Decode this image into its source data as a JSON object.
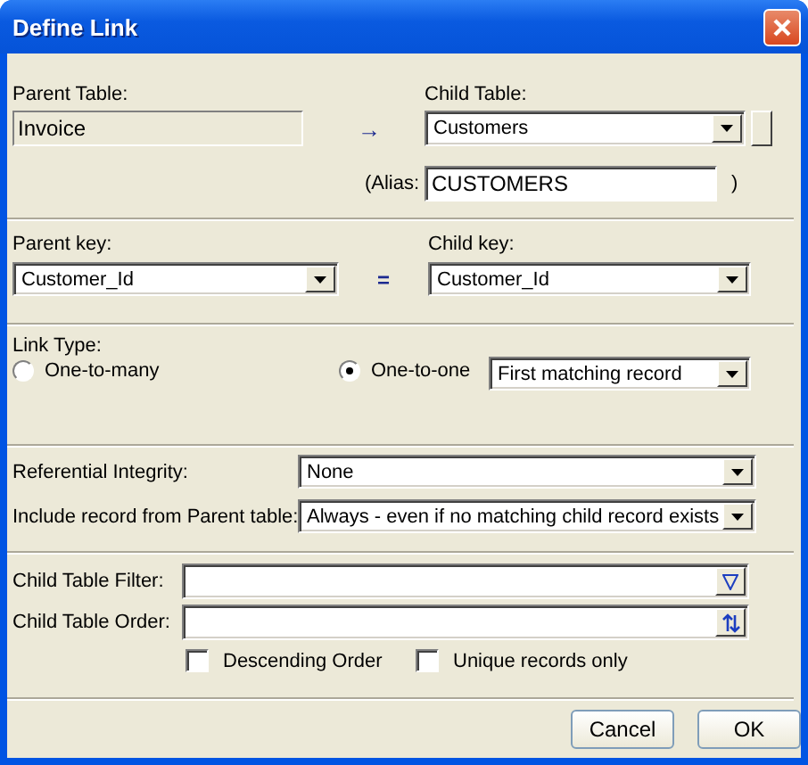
{
  "window": {
    "title": "Define Link"
  },
  "parent_table": {
    "label": "Parent Table:",
    "value": "Invoice"
  },
  "arrow": "→",
  "child_table": {
    "label": "Child Table:",
    "value": "Customers"
  },
  "alias": {
    "label": "(Alias:",
    "value": "CUSTOMERS",
    "close": ")"
  },
  "parent_key": {
    "label": "Parent key:",
    "value": "Customer_Id"
  },
  "equals": "=",
  "child_key": {
    "label": "Child key:",
    "value": "Customer_Id"
  },
  "link_type": {
    "label": "Link Type:",
    "options": [
      {
        "label": "One-to-many",
        "selected": false
      },
      {
        "label": "One-to-one",
        "selected": true
      }
    ],
    "match": "First matching record"
  },
  "referential_integrity": {
    "label": "Referential Integrity:",
    "value": "None"
  },
  "include_record": {
    "label": "Include record from Parent table:",
    "value": "Always - even if no matching child record exists"
  },
  "child_filter": {
    "label": "Child Table Filter:"
  },
  "child_order": {
    "label": "Child Table Order:"
  },
  "options": [
    {
      "label": "Descending Order",
      "checked": false
    },
    {
      "label": "Unique records only",
      "checked": false
    }
  ],
  "buttons": [
    "Cancel",
    "OK"
  ]
}
